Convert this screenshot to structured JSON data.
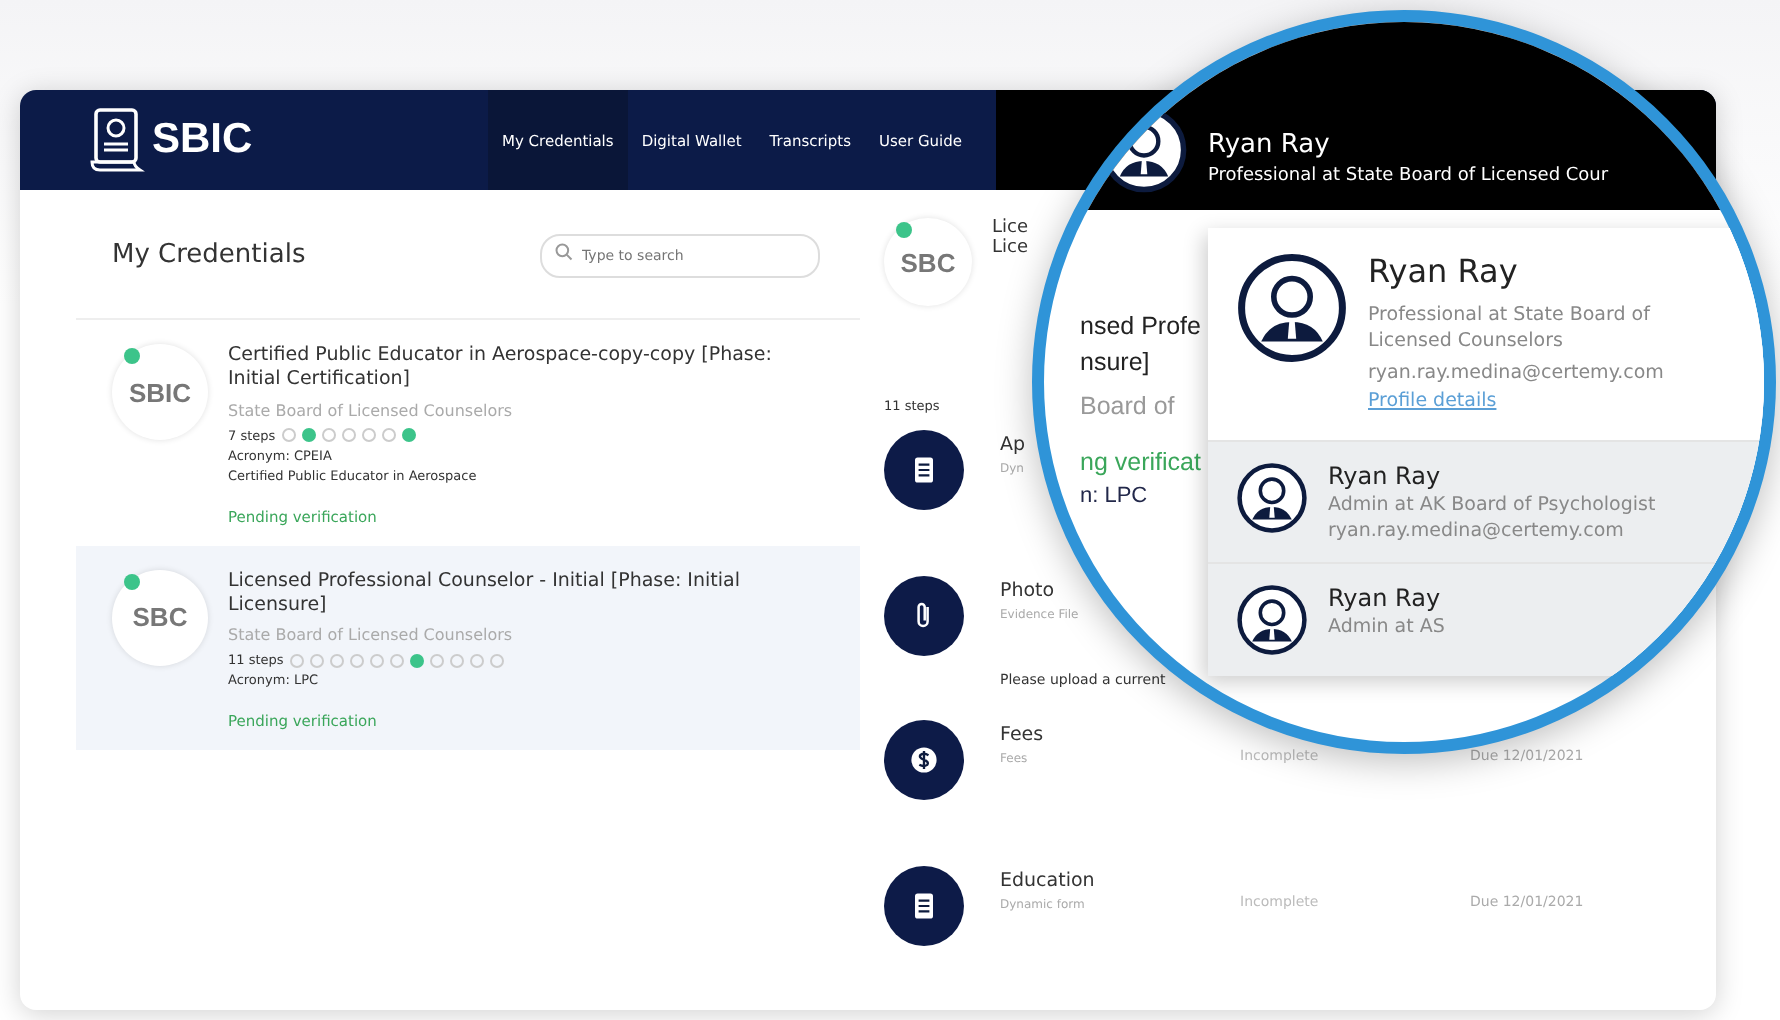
{
  "header": {
    "logo": "SBIC",
    "nav": [
      {
        "label": "My Credentials",
        "selected": true
      },
      {
        "label": "Digital Wallet",
        "selected": false
      },
      {
        "label": "Transcripts",
        "selected": false
      },
      {
        "label": "User Guide",
        "selected": false
      }
    ]
  },
  "credentials": {
    "title": "My Credentials",
    "search": {
      "placeholder": "Type to search"
    },
    "items": [
      {
        "logo": "SBIC",
        "title": "Certified Public Educator in Aerospace-copy-copy [Phase: Initial Certification]",
        "board": "State Board of Licensed Counselors",
        "steps_label": "7 steps",
        "steps": [
          false,
          true,
          false,
          false,
          false,
          false,
          true
        ],
        "acronym": "Acronym: CPEIA",
        "description": "Certified Public Educator in Aerospace",
        "status": "Pending verification",
        "selected": false
      },
      {
        "logo": "SBC",
        "title": "Licensed Professional Counselor - Initial [Phase: Initial Licensure]",
        "board": "State Board of Licensed Counselors",
        "steps_label": "11 steps",
        "steps": [
          false,
          false,
          false,
          false,
          false,
          false,
          true,
          false,
          false,
          false,
          false
        ],
        "acronym": "Acronym: LPC",
        "status": "Pending verification",
        "selected": true
      }
    ]
  },
  "detail": {
    "logo": "SBC",
    "title_lines": [
      "Lice",
      "Lice"
    ],
    "steps_label": "11 steps",
    "steps": [
      {
        "kind": "form",
        "title": "Ap",
        "subtitle": "Dyn"
      },
      {
        "kind": "file",
        "title": "Photo",
        "subtitle": "Evidence File",
        "note": "Please upload a current"
      },
      {
        "kind": "fee",
        "title": "Fees",
        "subtitle": "Fees",
        "status": "Incomplete",
        "due": "Due 12/01/2021"
      },
      {
        "kind": "form",
        "title": "Education",
        "subtitle": "Dynamic form",
        "status": "Incomplete",
        "due": "Due 12/01/2021"
      }
    ]
  },
  "magnifier": {
    "user": {
      "name": "Ryan Ray",
      "role": "Professional at State Board of Licensed Cour"
    },
    "fragments": [
      {
        "kind": "title",
        "text": "nsed Profe"
      },
      {
        "kind": "title",
        "text": "nsure]"
      },
      {
        "kind": "board",
        "text": "Board of"
      },
      {
        "kind": "status",
        "text": "ng verificat"
      },
      {
        "kind": "acronym",
        "text": "n: LPC"
      }
    ],
    "accounts": [
      {
        "name": "Ryan Ray",
        "role": "Professional at State Board of Licensed Counselors",
        "email": "ryan.ray.medina@certemy.com",
        "link": "Profile details",
        "selected": true
      },
      {
        "name": "Ryan Ray",
        "role": "Admin at AK Board of Psychologist",
        "email": "ryan.ray.medina@certemy.com",
        "selected": false
      },
      {
        "name": "Ryan Ray",
        "role": "Admin at AS",
        "selected": false
      }
    ]
  }
}
